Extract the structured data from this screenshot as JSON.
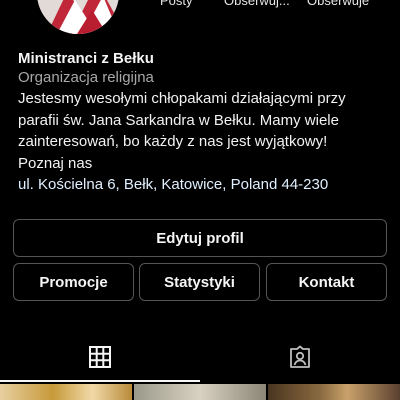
{
  "profile": {
    "name": "Ministranci z Bełku",
    "category": "Organizacja religijna",
    "bio_lines": [
      "Jestesmy wesołymi chłopakami działającymi przy",
      "parafii św. Jana Sarkandra w Bełku. Mamy wiele",
      "zainteresowań, bo każdy z nas jest wyjątkowy!",
      "Poznaj nas"
    ],
    "address": "ul. Kościelna 6, Bełk, Katowice, Poland 44-230"
  },
  "stats": {
    "posts_label": "Posty",
    "followers_label": "Obserwuj...",
    "following_label": "Obserwuje"
  },
  "buttons": {
    "edit_profile": "Edytuj profil",
    "promotions": "Promocje",
    "statistics": "Statystyki",
    "contact": "Kontakt"
  },
  "tabs": [
    {
      "icon": "grid-icon",
      "active": true
    },
    {
      "icon": "tagged-person-icon",
      "active": false
    }
  ],
  "colors": {
    "background": "#000000",
    "text": "#f5f5f5",
    "secondary_text": "#a8a8a8",
    "button_border": "#555555"
  }
}
